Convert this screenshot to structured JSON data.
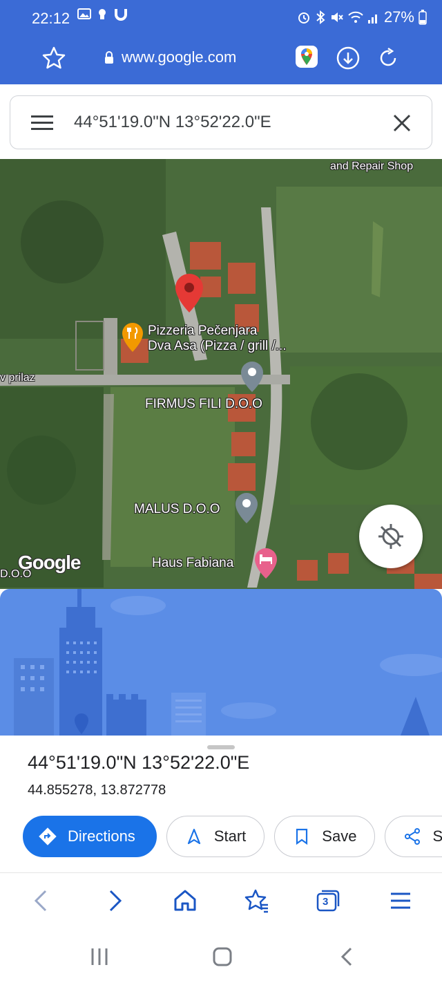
{
  "status_bar": {
    "time": "22:12",
    "battery": "27%"
  },
  "browser": {
    "url": "www.google.com"
  },
  "search": {
    "query": "44°51'19.0\"N 13°52'22.0\"E"
  },
  "map": {
    "labels": {
      "repair_shop": "and Repair Shop",
      "pizzeria_line1": "Pizzeria Pečenjara",
      "pizzeria_line2": "Dva Asa (Pizza / grill /...",
      "street": "v prilaz",
      "firmus": "FIRMUS FILI D.O.O",
      "malus": "MALUS D.O.O",
      "haus": "Haus Fabiana",
      "left_doo": "D.O.O"
    },
    "logo": "Google"
  },
  "place": {
    "title": "44°51'19.0\"N 13°52'22.0\"E",
    "decimal": "44.855278, 13.872778"
  },
  "actions": {
    "directions": "Directions",
    "start": "Start",
    "save": "Save",
    "share": "S"
  },
  "colors": {
    "browser_bar": "#3b6bd6",
    "primary": "#1a73e8",
    "pin_red": "#e53935",
    "pin_orange": "#f29900",
    "illustration": "#5b8de6"
  },
  "tabs_count": "3"
}
